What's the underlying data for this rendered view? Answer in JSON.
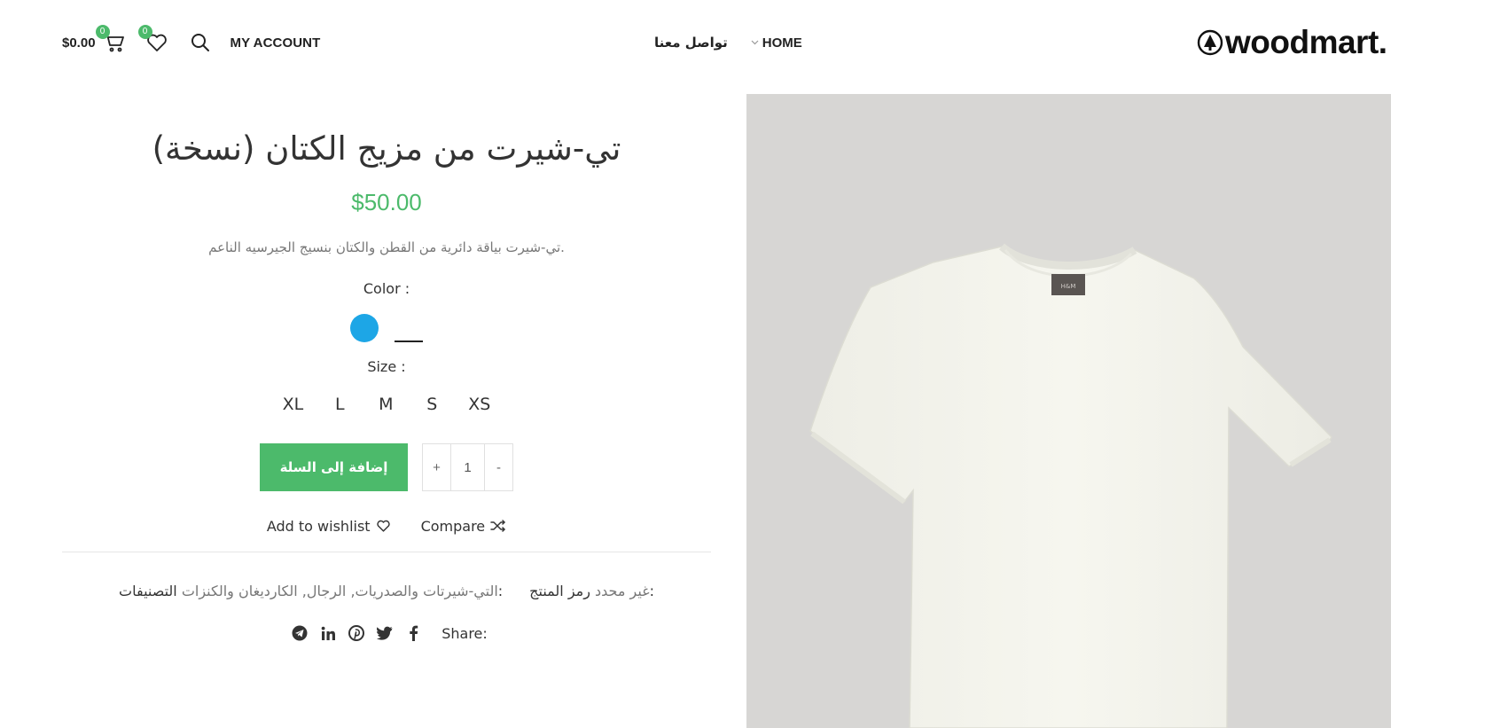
{
  "header": {
    "cart_total": "$0.00",
    "cart_count": "0",
    "wishlist_count": "0",
    "my_account": "MY ACCOUNT",
    "nav": {
      "contact": "تواصل معنا",
      "home": "HOME"
    },
    "logo": "woodmart."
  },
  "product": {
    "title": "تي-شيرت من مزيج الكتان (نسخة)",
    "price": "$50.00",
    "short_description": "تي-شيرت بياقة دائرية من القطن والكتان بنسيج الجيرسيه الناعم.",
    "color_label": "Color :",
    "color_swatch": "#1da6e6",
    "size_label": "Size :",
    "sizes": [
      "XL",
      "L",
      "M",
      "S",
      "XS"
    ],
    "add_to_cart": "إضافة إلى السلة",
    "quantity": {
      "plus": "+",
      "value": "1",
      "minus": "-"
    },
    "wishlist": "Add to wishlist",
    "compare": "Compare",
    "categories_label": "التصنيفات:",
    "categories": "التي-شيرتات والصدريات,  الرجال,  الكارديغان والكنزات",
    "sku_label": "رمز المنتج:",
    "sku_value": "غير محدد",
    "share_label": "Share:"
  },
  "colors": {
    "accent": "#4cba6b",
    "swatch_blue": "#1da6e6",
    "image_bg": "#d7d6d4"
  }
}
